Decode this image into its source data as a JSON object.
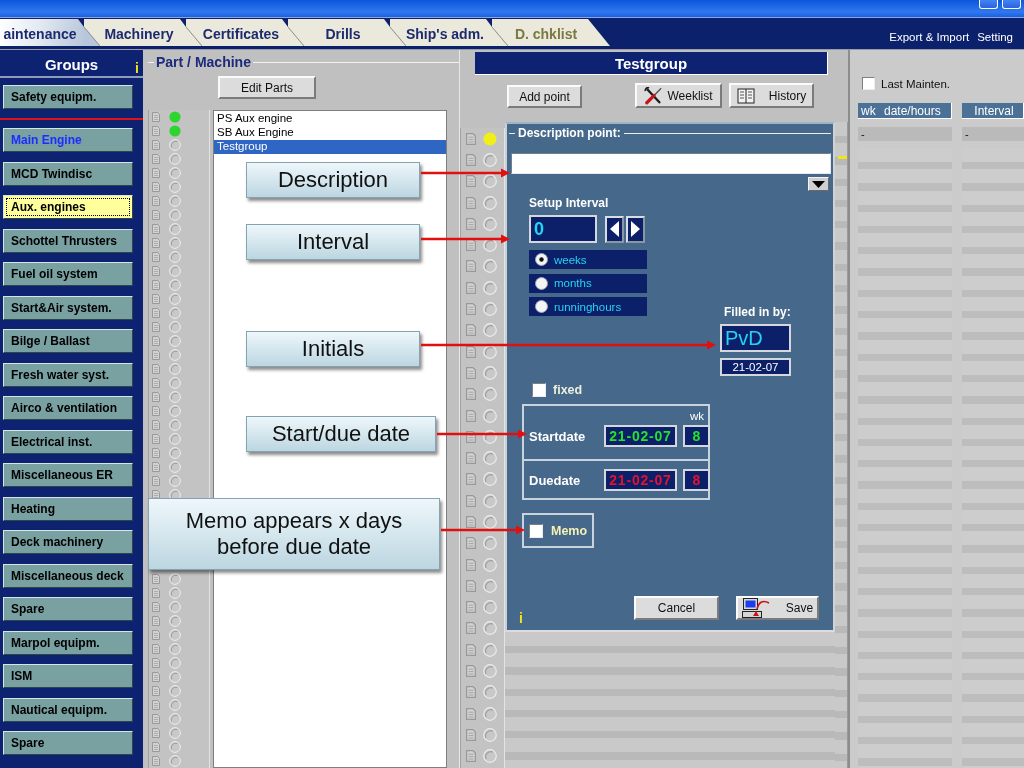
{
  "window": {
    "tabs": [
      {
        "label": "aintenance",
        "selected": true,
        "disabled": false
      },
      {
        "label": "Machinery",
        "selected": false,
        "disabled": false
      },
      {
        "label": "Certificates",
        "selected": false,
        "disabled": false
      },
      {
        "label": "Drills",
        "selected": false,
        "disabled": false
      },
      {
        "label": "Ship's adm.",
        "selected": false,
        "disabled": false
      },
      {
        "label": "D. chklist",
        "selected": false,
        "disabled": true
      }
    ],
    "menu": [
      "Export & Import",
      "Setting"
    ]
  },
  "groups": {
    "title": "Groups",
    "info": "i",
    "pinned": [
      {
        "label": "Safety equipm.",
        "selected": false,
        "highlighted": false
      }
    ],
    "items": [
      {
        "label": "Main Engine",
        "selected": false,
        "highlighted": true
      },
      {
        "label": "MCD Twindisc",
        "selected": false,
        "highlighted": false
      },
      {
        "label": "Aux. engines",
        "selected": true,
        "highlighted": false
      },
      {
        "label": "Schottel Thrusters",
        "selected": false,
        "highlighted": false
      },
      {
        "label": "Fuel oil system",
        "selected": false,
        "highlighted": false
      },
      {
        "label": "Start&Air system.",
        "selected": false,
        "highlighted": false
      },
      {
        "label": "Bilge / Ballast",
        "selected": false,
        "highlighted": false
      },
      {
        "label": "Fresh water syst.",
        "selected": false,
        "highlighted": false
      },
      {
        "label": "Airco & ventilation",
        "selected": false,
        "highlighted": false
      },
      {
        "label": "Electrical inst.",
        "selected": false,
        "highlighted": false
      },
      {
        "label": "Miscellaneous ER",
        "selected": false,
        "highlighted": false
      },
      {
        "label": "Heating",
        "selected": false,
        "highlighted": false
      },
      {
        "label": "Deck machinery",
        "selected": false,
        "highlighted": false
      },
      {
        "label": "Miscellaneous deck",
        "selected": false,
        "highlighted": false
      },
      {
        "label": "Spare",
        "selected": false,
        "highlighted": false
      },
      {
        "label": "Marpol equipm.",
        "selected": false,
        "highlighted": false
      },
      {
        "label": "ISM",
        "selected": false,
        "highlighted": false
      },
      {
        "label": "Nautical equipm.",
        "selected": false,
        "highlighted": false
      },
      {
        "label": "Spare",
        "selected": false,
        "highlighted": false
      }
    ]
  },
  "parts": {
    "title": "Part / Machine",
    "edit_button": "Edit Parts",
    "items": [
      {
        "name": "PS Aux engine",
        "lit": true,
        "color": "#2fd52f",
        "selected": false
      },
      {
        "name": "SB Aux Engine",
        "lit": true,
        "color": "#2fd52f",
        "selected": false
      },
      {
        "name": "Testgroup",
        "lit": false,
        "selected": true
      }
    ]
  },
  "points": {
    "title": "Testgroup",
    "buttons": [
      {
        "kind": "add",
        "label": "Add point"
      },
      {
        "kind": "weeklist",
        "label": "Weeklist"
      },
      {
        "kind": "history",
        "label": "History"
      }
    ],
    "items": [
      {
        "lit": true,
        "color": "#f2ee1a"
      }
    ]
  },
  "dialog": {
    "title": "Description point:",
    "interval": {
      "title": "Setup Interval",
      "value": "0",
      "units": [
        {
          "label": "weeks",
          "selected": true
        },
        {
          "label": "months",
          "selected": false
        },
        {
          "label": "runninghours",
          "selected": false
        }
      ]
    },
    "filled_in": {
      "label": "Filled in by:",
      "initials": "PvD",
      "date": "21-02-07"
    },
    "fixed": {
      "label": "fixed",
      "checked": false
    },
    "dates": {
      "wk_label": "wk",
      "rows": [
        {
          "kind": "start",
          "label": "Startdate",
          "date": "21-02-07",
          "week": "8"
        },
        {
          "kind": "due",
          "label": "Duedate",
          "date": "21-02-07",
          "week": "8"
        }
      ]
    },
    "memo": {
      "label": "Memo",
      "checked": false
    },
    "info": "i",
    "buttons": [
      {
        "kind": "cancel",
        "label": "Cancel"
      },
      {
        "kind": "save",
        "label": "Save"
      }
    ]
  },
  "last_maintenance": {
    "checkbox": {
      "label": "Last Mainten.",
      "checked": false
    },
    "columns": [
      "wk date/hours",
      "Interval"
    ],
    "rows": [
      [
        "-",
        "-"
      ]
    ]
  },
  "callouts": [
    {
      "text": "Description"
    },
    {
      "text": "Interval"
    },
    {
      "text": "Initials"
    },
    {
      "text": "Start/due date"
    },
    {
      "text": "Memo appears x days before due date"
    }
  ]
}
